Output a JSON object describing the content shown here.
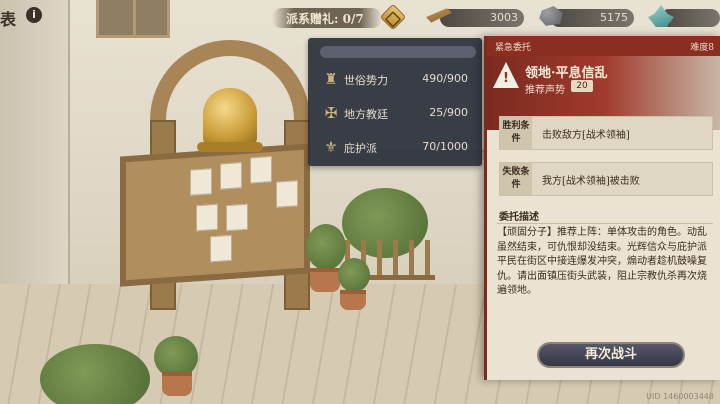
{
  "page": {
    "title_partial": "表"
  },
  "top_bar": {
    "faction_gift_label": "派系赠礼: 0/7",
    "resources": [
      {
        "icon": "wood-plank-icon",
        "value": "3003"
      },
      {
        "icon": "stone-ore-icon",
        "value": "5175"
      },
      {
        "icon": "crystal-icon",
        "value": ""
      }
    ]
  },
  "faction_panel": {
    "rows": [
      {
        "icon": "secular-power-icon",
        "name": "世俗势力",
        "value": "490/900"
      },
      {
        "icon": "local-church-icon",
        "name": "地方教廷",
        "value": "25/900"
      },
      {
        "icon": "protector-faction-icon",
        "name": "庇护派",
        "value": "70/1000"
      }
    ]
  },
  "quest": {
    "tag": "紧急委托",
    "difficulty": "难度8",
    "title": "领地·平息信乱",
    "recommend_label": "推荐声势",
    "recommend_value": "20",
    "win_label": "胜利条件",
    "win_text": "击败敌方[战术领袖]",
    "lose_label": "失败条件",
    "lose_text": "我方[战术领袖]被击败",
    "desc_title": "委托描述",
    "desc_text": "【顽固分子】推荐上阵：单体攻击的角色。动乱虽然结束，可仇恨却没结束。光辉信众与庇护派平民在街区中接连爆发冲突，煽动者趁机鼓噪复仇。请出面镇压街头武装，阻止宗教仇杀再次烧遍领地。",
    "retry_label": "再次战斗"
  },
  "footer": {
    "uid": "UID 1460003448"
  },
  "colors": {
    "accent_red": "#8a2e22",
    "panel_dark": "#2e333e",
    "parchment": "#ebe3d2",
    "gold": "#cdb77f"
  }
}
